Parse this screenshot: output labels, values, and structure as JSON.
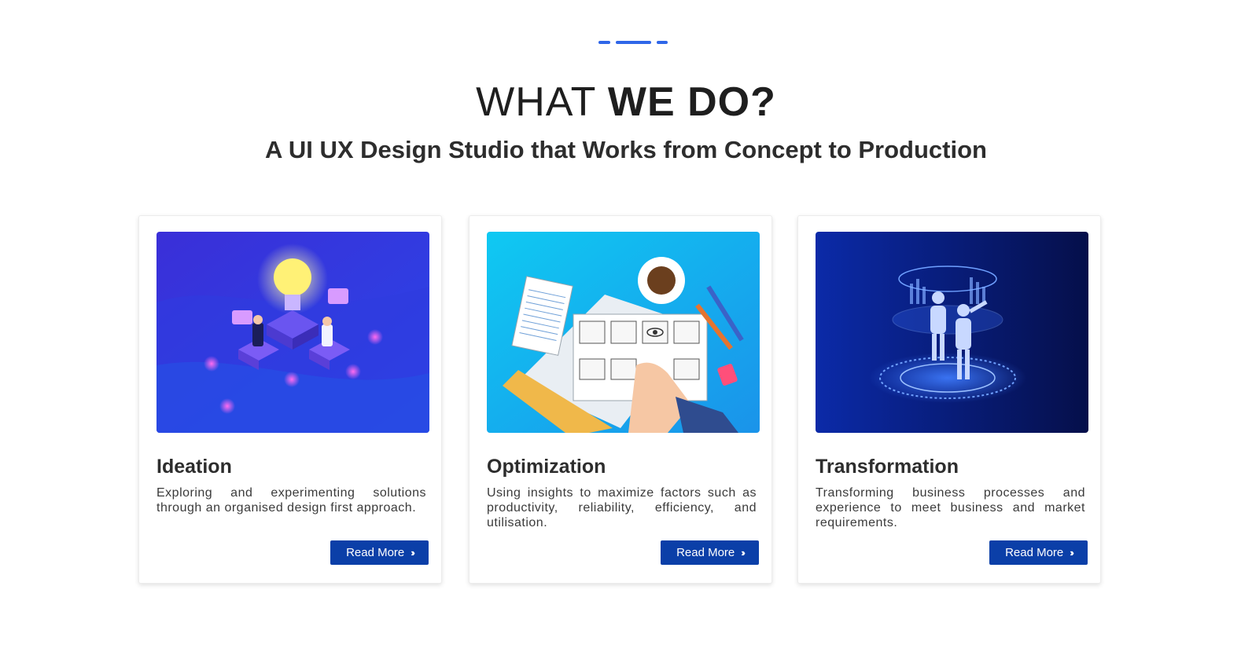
{
  "section": {
    "heading_light": "WHAT ",
    "heading_bold": "WE DO?",
    "subheading": "A UI UX Design Studio that Works from Concept to Production"
  },
  "colors": {
    "accent": "#2f66e8",
    "button": "#0b3fa8"
  },
  "cards": [
    {
      "title": "Ideation",
      "description": "Exploring and experimenting solutions through an organised design first approach.",
      "button_label": "Read More",
      "button_icon": "double-chevron-right-icon",
      "illustration": "ideation-illustration"
    },
    {
      "title": "Optimization",
      "description": "Using insights to maximize factors such as productivity, reliability, efficiency, and utilisation.",
      "button_label": "Read More",
      "button_icon": "double-chevron-right-icon",
      "illustration": "optimization-illustration"
    },
    {
      "title": "Transformation",
      "description": "Transforming business processes and experience to meet business and market requirements.",
      "button_label": "Read More",
      "button_icon": "double-chevron-right-icon",
      "illustration": "transformation-illustration"
    }
  ]
}
